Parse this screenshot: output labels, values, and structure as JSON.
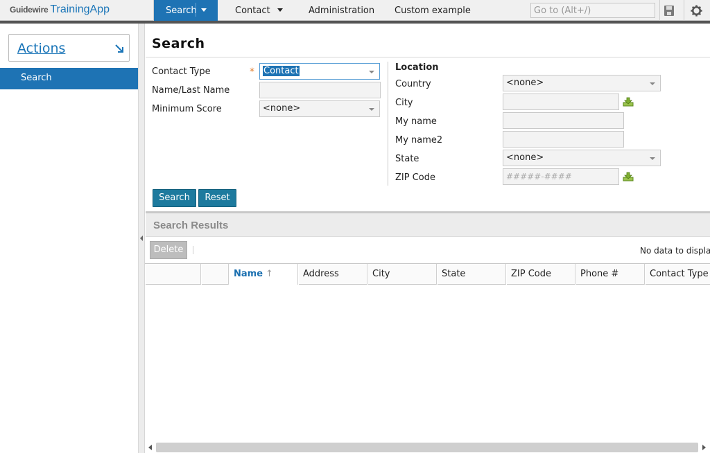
{
  "brand": {
    "company": "Guidewire",
    "app": "TrainingApp"
  },
  "nav": {
    "search": "Search",
    "contact": "Contact",
    "administration": "Administration",
    "custom": "Custom example",
    "goto_placeholder": "Go to (Alt+/)"
  },
  "sidebar": {
    "actions": "Actions",
    "items": [
      {
        "label": "Search"
      }
    ]
  },
  "page": {
    "title": "Search"
  },
  "form": {
    "contact_type_label": "Contact Type",
    "contact_type_value": "Contact",
    "name_label": "Name/Last Name",
    "name_value": "",
    "min_score_label": "Minimum Score",
    "min_score_value": "<none>",
    "location_title": "Location",
    "country_label": "Country",
    "country_value": "<none>",
    "city_label": "City",
    "city_value": "",
    "myname_label": "My name",
    "myname_value": "",
    "myname2_label": "My name2",
    "myname2_value": "",
    "state_label": "State",
    "state_value": "<none>",
    "zip_label": "ZIP Code",
    "zip_placeholder": "#####-####",
    "search_button": "Search",
    "reset_button": "Reset"
  },
  "results": {
    "title": "Search Results",
    "delete_button": "Delete",
    "empty_text": "No data to display",
    "columns": [
      "Name",
      "Address",
      "City",
      "State",
      "ZIP Code",
      "Phone #",
      "Contact Type"
    ]
  },
  "colors": {
    "accent": "#1e73b4",
    "button": "#1d7a9e",
    "required": "#e07a28"
  }
}
